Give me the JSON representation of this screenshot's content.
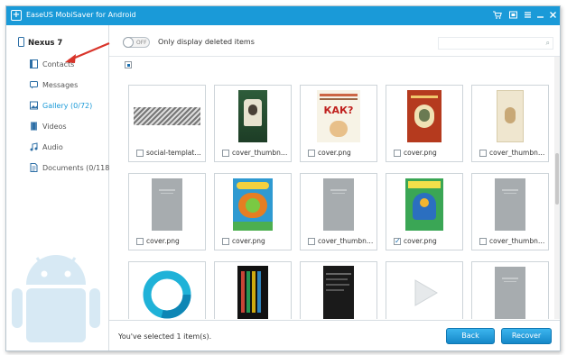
{
  "app": {
    "title": "EaseUS MobiSaver for Android"
  },
  "titlebar": {
    "icons": [
      "cart-icon",
      "register-icon",
      "menu-icon",
      "minimize-icon",
      "close-icon"
    ]
  },
  "sidebar": {
    "device": "Nexus 7",
    "items": [
      {
        "label": "Contacts",
        "icon": "contacts-icon"
      },
      {
        "label": "Messages",
        "icon": "messages-icon"
      },
      {
        "label": "Gallery (0/72)",
        "icon": "gallery-icon",
        "active": true
      },
      {
        "label": "Videos",
        "icon": "videos-icon"
      },
      {
        "label": "Audio",
        "icon": "audio-icon"
      },
      {
        "label": "Documents (0/118)",
        "icon": "documents-icon"
      }
    ]
  },
  "toolbar": {
    "toggle_text": "OFF",
    "filter_label": "Only display deleted items",
    "search_placeholder": ""
  },
  "grid": {
    "rows": [
      [
        {
          "name": "social-template...",
          "checked": false
        },
        {
          "name": "cover_thumbnai...",
          "checked": false
        },
        {
          "name": "cover.png",
          "checked": false
        },
        {
          "name": "cover.png",
          "checked": false
        },
        {
          "name": "cover_thumbnai...",
          "checked": false
        }
      ],
      [
        {
          "name": "cover.png",
          "checked": false
        },
        {
          "name": "cover.png",
          "checked": false
        },
        {
          "name": "cover_thumbnai...",
          "checked": false
        },
        {
          "name": "cover.png",
          "checked": true
        },
        {
          "name": "cover_thumbnai...",
          "checked": false
        }
      ]
    ],
    "book_title": "КАК?"
  },
  "footer": {
    "status": "You've selected 1 item(s).",
    "back_label": "Back",
    "recover_label": "Recover"
  },
  "colors": {
    "accent": "#1a9ad8",
    "button": "#1588c8"
  }
}
